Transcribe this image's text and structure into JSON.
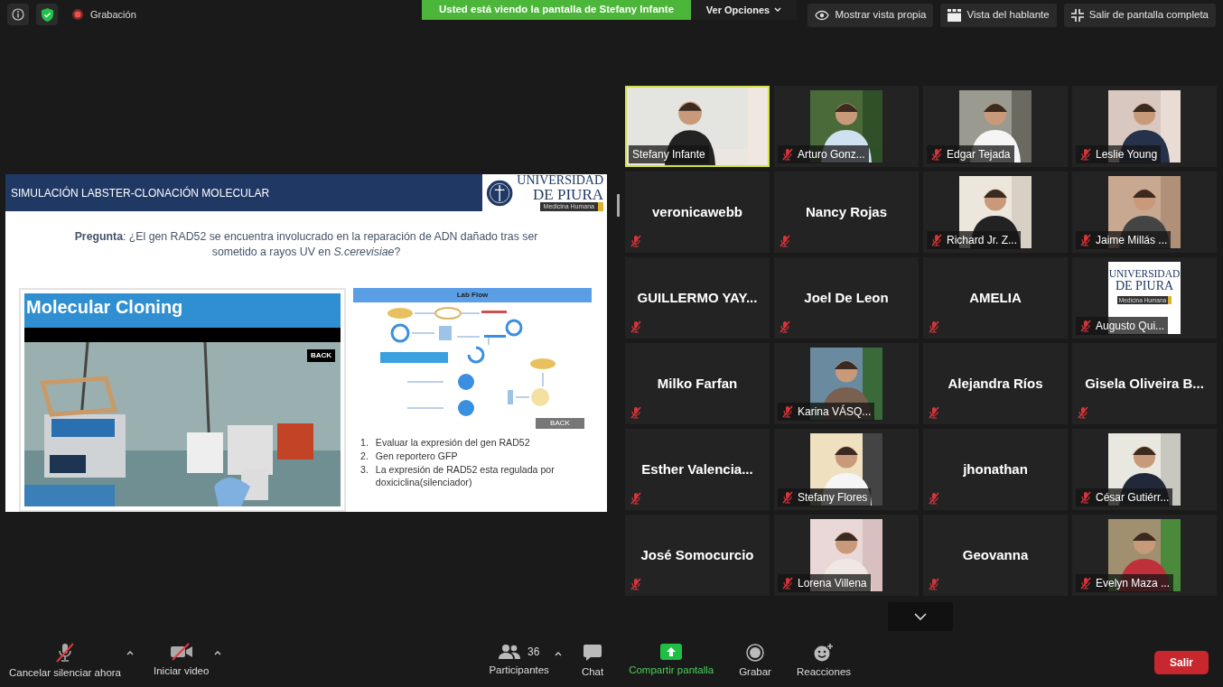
{
  "top_bar": {
    "recording_label": "Grabación",
    "share_banner": "Usted está viendo la pantalla de Stefany Infante",
    "view_options": "Ver Opciones",
    "buttons": [
      {
        "label": "Mostrar vista propia",
        "kind": "eye"
      },
      {
        "label": "Vista del hablante",
        "kind": "speaker"
      },
      {
        "label": "Salir de pantalla completa",
        "kind": "exit"
      }
    ]
  },
  "slide": {
    "title": "SIMULACIÓN LABSTER-CLONACIÓN MOLECULAR",
    "logo": {
      "line1": "UNIVERSIDAD",
      "line2": "DE PIURA",
      "tagline": "Medicina Humana"
    },
    "question": "**Pregunta**: ¿El gen RAD52 se encuentra involucrado en la reparación de ADN dañado tras ser sometido a rayos UV en *S.cerevisiae*?",
    "screenshot": {
      "title": "Molecular Cloning",
      "back": "BACK"
    },
    "lab_flow": {
      "title": "Lab Flow",
      "back": "BACK"
    },
    "list": [
      {
        "number": "1.",
        "text": "Evaluar la expresión del gen RAD52"
      },
      {
        "number": "2.",
        "text": "Gen reportero GFP"
      },
      {
        "number": "3.",
        "text": "La expresión de RAD52 esta regulada por doxiciclina(silenciador)"
      }
    ]
  },
  "participants": [
    {
      "name": "Stefany Infante",
      "kind": "video",
      "muted": false,
      "active_speaker": true
    },
    {
      "name": "Arturo Gonz...",
      "kind": "video",
      "muted": true,
      "active_speaker": false
    },
    {
      "name": "Edgar Tejada",
      "kind": "video",
      "muted": true,
      "active_speaker": false
    },
    {
      "name": "Leslie Young",
      "kind": "video",
      "muted": true,
      "active_speaker": false
    },
    {
      "name": "veronicawebb",
      "kind": "name",
      "muted": true,
      "active_speaker": false
    },
    {
      "name": "Nancy Rojas",
      "kind": "name",
      "muted": true,
      "active_speaker": false
    },
    {
      "name": "Richard Jr. Z...",
      "kind": "video",
      "muted": true,
      "active_speaker": false
    },
    {
      "name": "Jaime Millás ...",
      "kind": "video",
      "muted": true,
      "active_speaker": false
    },
    {
      "name": "GUILLERMO YAY...",
      "kind": "name",
      "muted": true,
      "active_speaker": false
    },
    {
      "name": "Joel De Leon",
      "kind": "name",
      "muted": true,
      "active_speaker": false
    },
    {
      "name": "AMELIA",
      "kind": "name",
      "muted": true,
      "active_speaker": false
    },
    {
      "name": "Augusto Qui...",
      "kind": "logo",
      "muted": true,
      "active_speaker": false,
      "logo": {
        "line1": "UNIVERSIDAD",
        "line2": "DE PIURA",
        "tagline": "Medicina Humana"
      }
    },
    {
      "name": "Milko Farfan",
      "kind": "name",
      "muted": true,
      "active_speaker": false
    },
    {
      "name": "Karina VÁSQ...",
      "kind": "video",
      "muted": true,
      "active_speaker": false
    },
    {
      "name": "Alejandra Ríos",
      "kind": "name",
      "muted": true,
      "active_speaker": false
    },
    {
      "name": "Gisela  Oliveira  B...",
      "kind": "name",
      "muted": true,
      "active_speaker": false
    },
    {
      "name": "Esther  Valencia...",
      "kind": "name",
      "muted": true,
      "active_speaker": false
    },
    {
      "name": "Stefany Flores",
      "kind": "video",
      "muted": true,
      "active_speaker": false
    },
    {
      "name": "jhonathan",
      "kind": "name",
      "muted": true,
      "active_speaker": false
    },
    {
      "name": "César Gutiérr...",
      "kind": "video",
      "muted": true,
      "active_speaker": false
    },
    {
      "name": "José Somocurcio",
      "kind": "name",
      "muted": true,
      "active_speaker": false
    },
    {
      "name": "Lorena Villena",
      "kind": "video",
      "muted": true,
      "active_speaker": false
    },
    {
      "name": "Geovanna",
      "kind": "name",
      "muted": true,
      "active_speaker": false
    },
    {
      "name": "Evelyn Maza ...",
      "kind": "video",
      "muted": true,
      "active_speaker": false
    }
  ],
  "toolbar": {
    "left": [
      {
        "label": "Cancelar silenciar ahora",
        "kind": "mic",
        "caret": true
      },
      {
        "label": "Iniciar video",
        "kind": "video",
        "caret": true
      }
    ],
    "center": [
      {
        "label": "Participantes",
        "kind": "people",
        "count": "36",
        "caret": true,
        "accent": false
      },
      {
        "label": "Chat",
        "kind": "chat",
        "caret": false,
        "accent": false
      },
      {
        "label": "Compartir pantalla",
        "kind": "share",
        "caret": false,
        "accent": true
      },
      {
        "label": "Grabar",
        "kind": "record",
        "caret": false,
        "accent": false
      },
      {
        "label": "Reacciones",
        "kind": "emoji",
        "caret": false,
        "accent": false
      }
    ],
    "leave": "Salir"
  }
}
